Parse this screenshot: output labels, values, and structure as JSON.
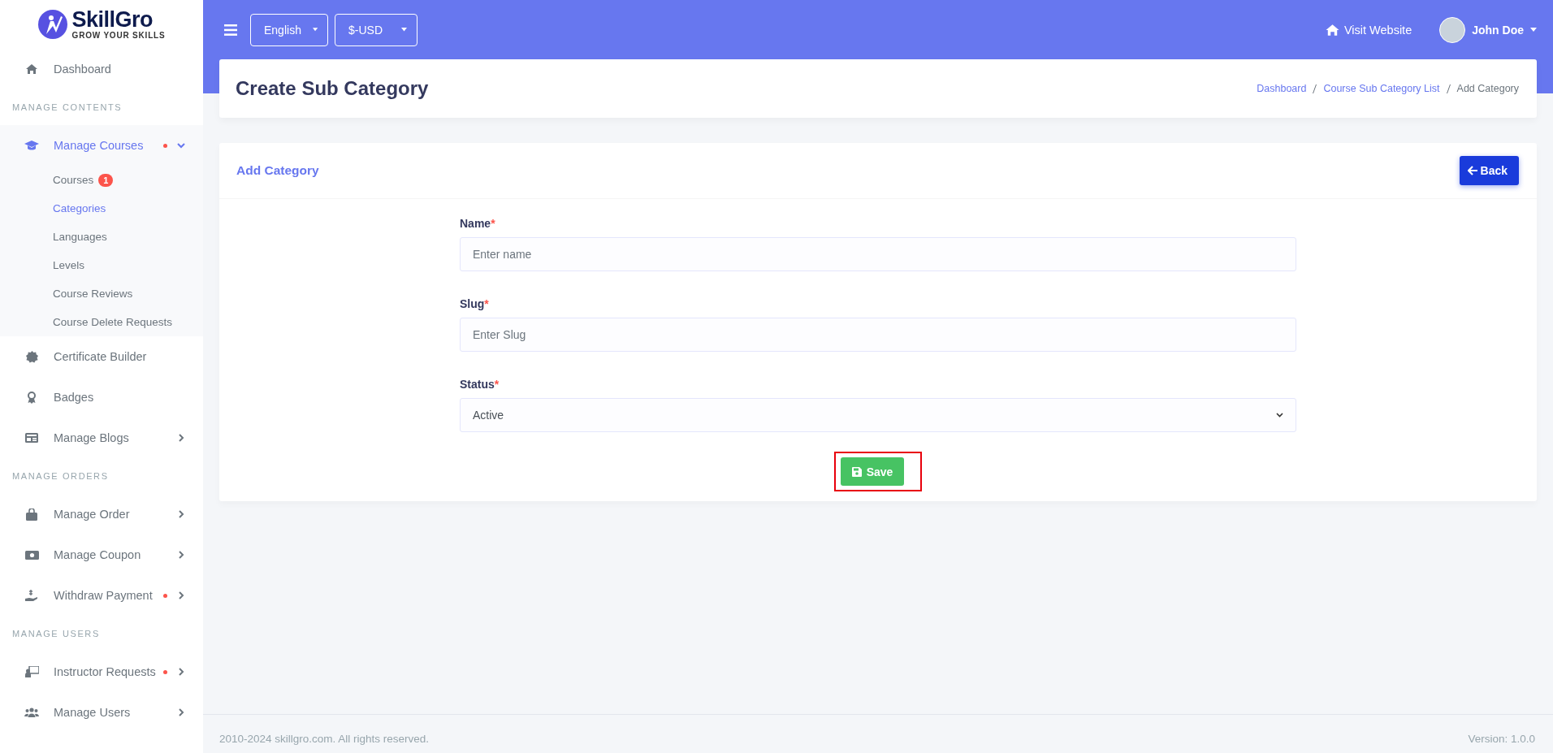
{
  "brand": {
    "name": "SkillGro",
    "tagline": "GROW YOUR SKILLS"
  },
  "sidebar": {
    "items": [
      {
        "kind": "link",
        "label": "Dashboard"
      },
      {
        "kind": "section",
        "label": "MANAGE CONTENTS"
      },
      {
        "kind": "group",
        "label": "Manage Courses",
        "expanded": true,
        "alert": true,
        "children": [
          {
            "label": "Courses",
            "badge": "1",
            "selected": false
          },
          {
            "label": "Categories",
            "selected": true
          },
          {
            "label": "Languages",
            "selected": false
          },
          {
            "label": "Levels",
            "selected": false
          },
          {
            "label": "Course Reviews",
            "selected": false
          },
          {
            "label": "Course Delete Requests",
            "selected": false
          }
        ]
      },
      {
        "kind": "link",
        "label": "Certificate Builder"
      },
      {
        "kind": "link",
        "label": "Badges"
      },
      {
        "kind": "group",
        "label": "Manage Blogs",
        "expanded": false,
        "alert": false
      },
      {
        "kind": "section",
        "label": "MANAGE ORDERS"
      },
      {
        "kind": "group",
        "label": "Manage Order",
        "expanded": false,
        "alert": false
      },
      {
        "kind": "group",
        "label": "Manage Coupon",
        "expanded": false,
        "alert": false
      },
      {
        "kind": "group",
        "label": "Withdraw Payment",
        "expanded": false,
        "alert": true
      },
      {
        "kind": "section",
        "label": "MANAGE USERS"
      },
      {
        "kind": "group",
        "label": "Instructor Requests",
        "expanded": false,
        "alert": true
      },
      {
        "kind": "group",
        "label": "Manage Users",
        "expanded": false,
        "alert": false
      }
    ]
  },
  "topbar": {
    "language": "English",
    "currency": "$-USD",
    "visit_link": "Visit Website",
    "user": "John Doe"
  },
  "page_header": {
    "title": "Create Sub Category",
    "breadcrumb": [
      {
        "label": "Dashboard",
        "link": true
      },
      {
        "label": "Course Sub Category List",
        "link": true
      },
      {
        "label": "Add Category",
        "link": false
      }
    ]
  },
  "card": {
    "title": "Add Category",
    "back_button": "Back",
    "fields": [
      {
        "kind": "text",
        "label": "Name",
        "required_mark": "*",
        "placeholder": "Enter name"
      },
      {
        "kind": "text",
        "label": "Slug",
        "required_mark": "*",
        "placeholder": "Enter Slug"
      },
      {
        "kind": "select",
        "label": "Status",
        "required_mark": "*",
        "value": "Active"
      }
    ],
    "save_button": "Save",
    "save_highlighted": true
  },
  "footer": {
    "copyright": "2010-2024 skillgro.com. All rights reserved.",
    "version": "Version: 1.0.0"
  }
}
